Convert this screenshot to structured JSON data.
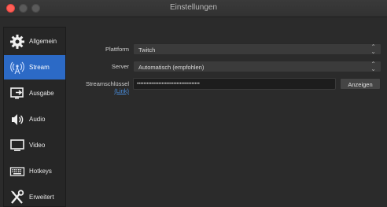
{
  "window": {
    "title": "Einstellungen"
  },
  "sidebar": {
    "items": [
      {
        "label": "Allgemein",
        "icon": "gear-icon"
      },
      {
        "label": "Stream",
        "icon": "stream-antenna-icon",
        "active": true
      },
      {
        "label": "Ausgabe",
        "icon": "output-icon"
      },
      {
        "label": "Audio",
        "icon": "speaker-icon"
      },
      {
        "label": "Video",
        "icon": "monitor-icon"
      },
      {
        "label": "Hotkeys",
        "icon": "keyboard-icon"
      },
      {
        "label": "Erweitert",
        "icon": "wrench-screwdriver-icon"
      }
    ]
  },
  "form": {
    "platform_label": "Plattform",
    "platform_value": "Twitch",
    "server_label": "Server",
    "server_value": "Automatisch (empfohlen)",
    "key_label": "Streamschlüssel",
    "key_link": "(Link)",
    "key_value": "••••••••••••••••••••••••••••••••••••••",
    "show_button": "Anzeigen"
  },
  "colors": {
    "accent": "#2c6ac6",
    "close": "#ff5f57"
  }
}
